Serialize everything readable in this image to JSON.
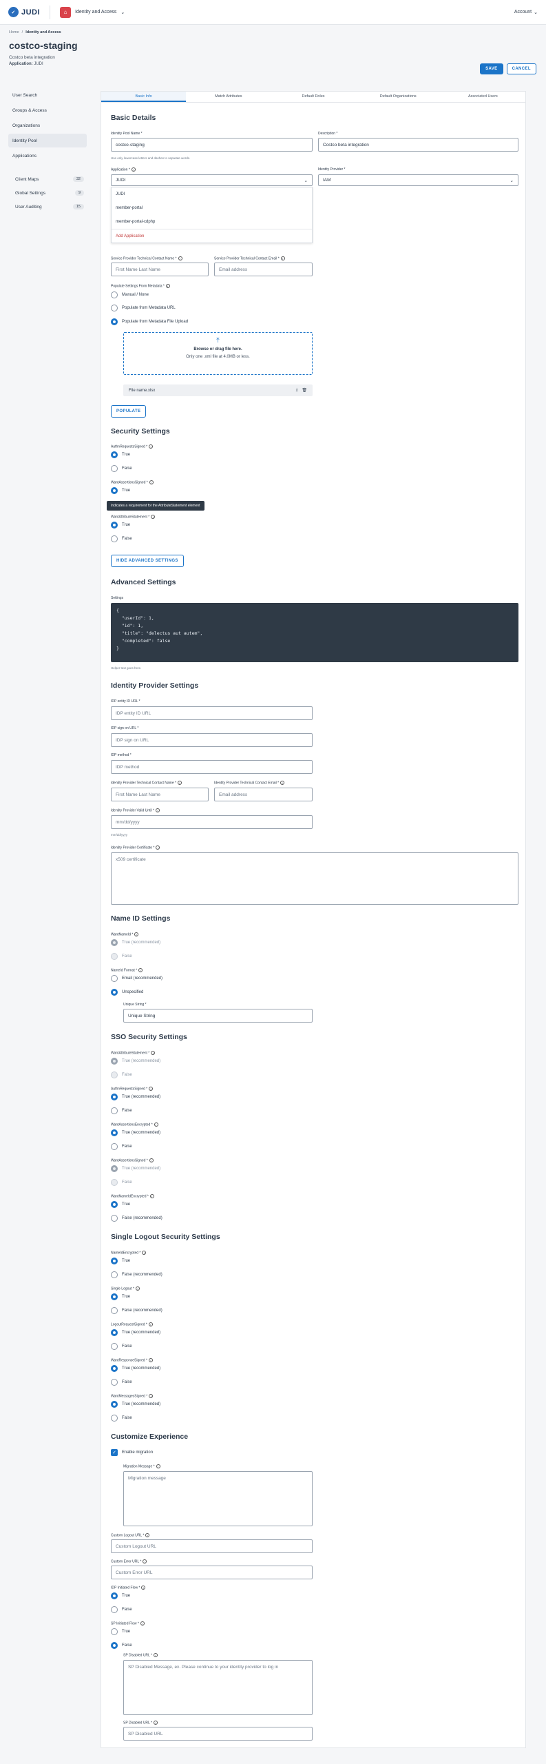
{
  "topbar": {
    "logo_text": "JUDI",
    "logo_icon": "judi-logo-icon",
    "app_name": "Identity and Access",
    "account_label": "Account"
  },
  "breadcrumb": [
    "Home",
    "Identity and Access"
  ],
  "header": {
    "title": "costco-staging",
    "subtitle": "Costco beta integration",
    "app_label": "Application:",
    "app_value": "JUDI",
    "save_label": "SAVE",
    "cancel_label": "CANCEL"
  },
  "sidebar": {
    "items": [
      "User Search",
      "Groups & Access",
      "Organizations",
      "Identity Pool",
      "Applications"
    ],
    "sub_items": [
      {
        "label": "Client Maps",
        "count": "32"
      },
      {
        "label": "Global Settings",
        "count": "9"
      },
      {
        "label": "User Auditing",
        "count": "15"
      }
    ]
  },
  "tabs": [
    "Basic Info",
    "Match Attributes",
    "Default Roles",
    "Default Organizations",
    "Associated Users"
  ],
  "basic": {
    "heading": "Basic Details",
    "pool_name_label": "Identity Pool Name *",
    "pool_name_value": "costco-staging",
    "pool_name_help": "Use only lowercase letters and dashes to separate words.",
    "description_label": "Description *",
    "description_value": "Costco beta integration",
    "application_label": "Application *",
    "application_value": "JUDI",
    "provider_label": "Identity Provider *",
    "provider_value": "IAM",
    "dropdown_options": [
      "JUDI",
      "member-portal",
      "member-portal-cdphp"
    ],
    "dropdown_add": "Add Application",
    "sp_name_label": "Service Provider Technical Contact Name *",
    "sp_name_placeholder": "First Name Last Name",
    "sp_email_label": "Service Provider Technical Contact Email *",
    "sp_email_placeholder": "Email address",
    "populate_label": "Populate Settings From Metadata *",
    "populate_options": [
      "Manual / None",
      "Populate from Metadata URL",
      "Populate from Metadata File Upload"
    ],
    "upload_title": "Browse or drag file here.",
    "upload_help": "Only one .xml file at 4.0MB or less.",
    "file_name": "File name.xlsx",
    "populate_button": "POPULATE"
  },
  "security": {
    "heading": "Security Settings",
    "authn_label": "AuthnRequestsSigned *",
    "want_assert_label": "WantAssertionsSigned *",
    "want_attr_label": "WantAttributeStatement *",
    "opt_true": "True",
    "opt_false": "False",
    "tooltip": "Indicates a requirement for the AttributeStatement element",
    "hide_button": "HIDE ADVANCED SETTINGS"
  },
  "advanced": {
    "heading": "Advanced Settings",
    "settings_label": "Settings",
    "code_lines": [
      "{",
      "  \"userId\": 1,",
      "  \"id\": 1,",
      "  \"title\": \"delectus aut autem\",",
      "  \"completed\": false",
      "}"
    ],
    "helper": "Helper text goes here."
  },
  "idp": {
    "heading": "Identity Provider Settings",
    "entity_label": "IDP entity ID URL *",
    "entity_placeholder": "IDP entity ID URL",
    "signon_label": "IDP sign on URL *",
    "signon_placeholder": "IDP sign on URL",
    "method_label": "IDP method *",
    "method_placeholder": "IDP method",
    "contact_name_label": "Identity Provider Technical Contact Name *",
    "contact_name_placeholder": "First Name Last Name",
    "contact_email_label": "Identity Provider Technical Contact Email *",
    "contact_email_placeholder": "Email address",
    "valid_until_label": "Identity Provider Valid Until *",
    "valid_until_placeholder": "mm/dd/yyyy",
    "valid_until_help": "mm/dd/yyyy",
    "cert_label": "Identity Provider Certificate *",
    "cert_placeholder": "x509 certificate"
  },
  "nameid": {
    "heading": "Name ID Settings",
    "want_label": "WantNameId *",
    "true_rec": "True (recommended)",
    "false": "False",
    "format_label": "NameId Format *",
    "email_rec": "Email (recommended)",
    "unspecified": "Unspecified",
    "unique_label": "Unique String *",
    "unique_value": "Unique String"
  },
  "sso": {
    "heading": "SSO Security Settings",
    "groups": [
      {
        "label": "WantAttributeStatement *",
        "a": "True (recommended)",
        "b": "False"
      },
      {
        "label": "AuthnRequestsSigned *",
        "a": "True (recommended)",
        "b": "False"
      },
      {
        "label": "WantAssertionsEncrypted *",
        "a": "True (recommended)",
        "b": "False"
      },
      {
        "label": "WantAssertionsSigned *",
        "a": "True (recommended)",
        "b": "False"
      },
      {
        "label": "WantNameIdEncrypted *",
        "a": "True",
        "b": "False (recommended)"
      }
    ]
  },
  "slo": {
    "heading": "Single Logout Security Settings",
    "groups": [
      {
        "label": "NameIdEncrypted *",
        "a": "True",
        "b": "False (recommended)"
      },
      {
        "label": "Single Logout *",
        "a": "True",
        "b": "False (recommended)"
      },
      {
        "label": "LogoutRequestSigned *",
        "a": "True (recommended)",
        "b": "False"
      },
      {
        "label": "WantResponseSigned *",
        "a": "True (recommended)",
        "b": "False"
      },
      {
        "label": "WantMessagesSigned *",
        "a": "True (recommended)",
        "b": "False"
      }
    ]
  },
  "custom": {
    "heading": "Customize Experience",
    "enable_migration": "Enable migration",
    "migration_label": "Migration Message *",
    "migration_placeholder": "Migration message",
    "logout_label": "Custom Logout URL *",
    "logout_placeholder": "Custom Logout URL",
    "error_label": "Custom Error URL *",
    "error_placeholder": "Custom Error URL",
    "idp_flow_label": "IDP Initiated Flow *",
    "sp_flow_label": "SP Initiated Flow *",
    "opt_true": "True",
    "opt_false": "False",
    "sp_disabled_label": "SP Disabled URL *",
    "sp_disabled_message": "SP Disabled Message, ex. Please continue to your identity provider to log in",
    "sp_disabled_url_label": "SP Disabled URL *",
    "sp_disabled_url_placeholder": "SP Disabled URL"
  }
}
